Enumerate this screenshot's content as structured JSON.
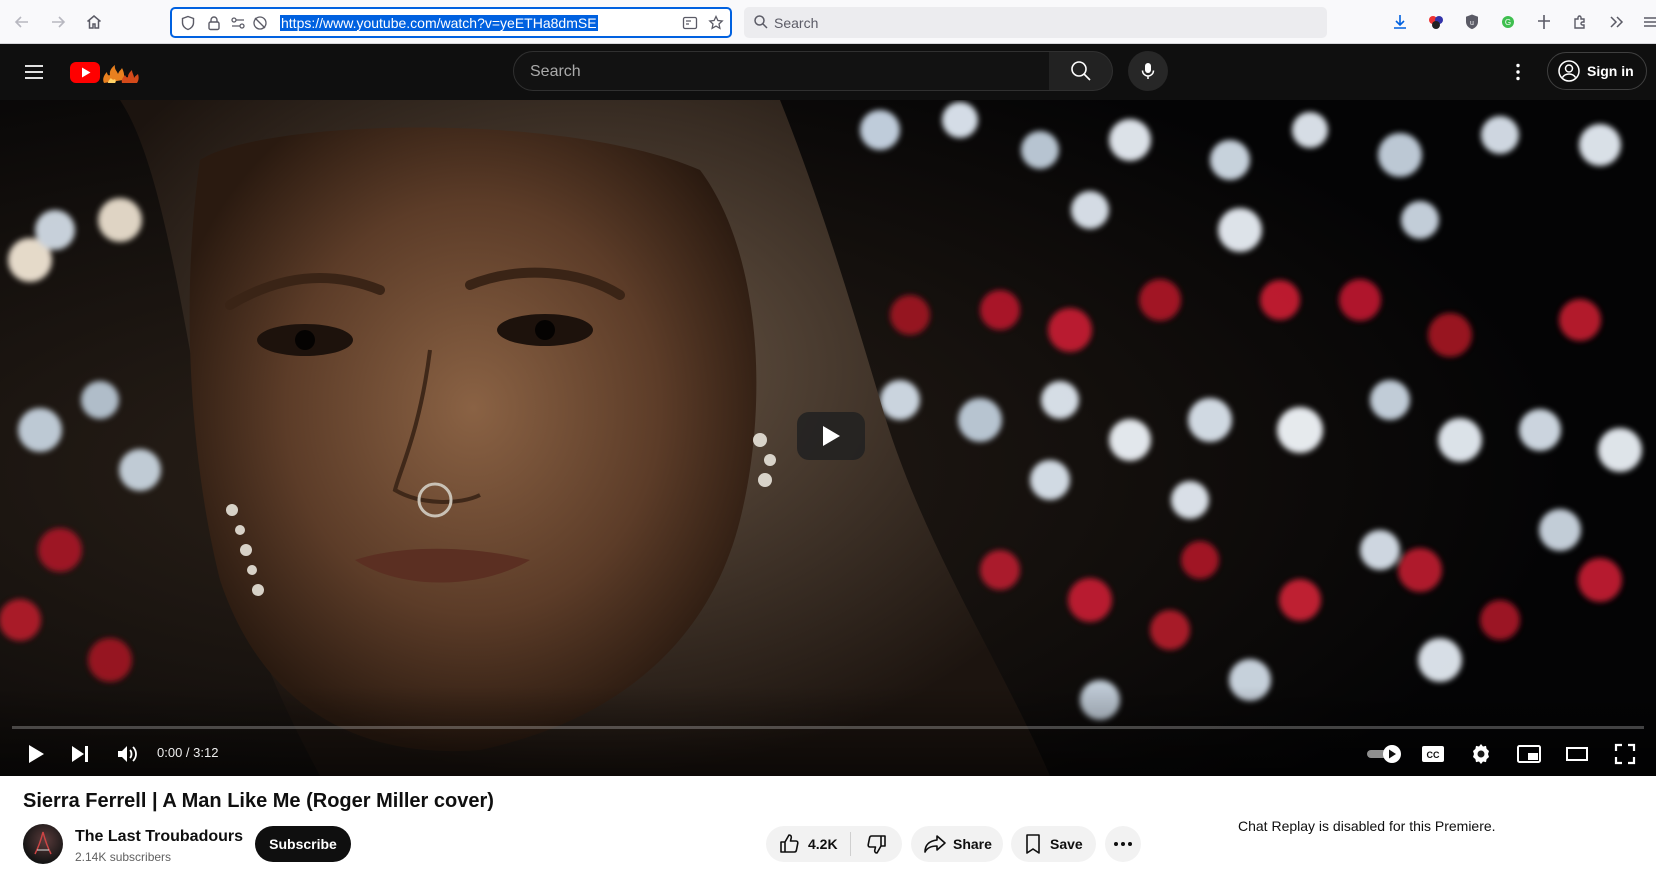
{
  "browser": {
    "url": "https://www.youtube.com/watch?v=yeETHa8dmSE",
    "search_placeholder": "Search"
  },
  "youtube": {
    "search_placeholder": "Search",
    "sign_in_label": "Sign in"
  },
  "player": {
    "time_display": "0:00 / 3:12",
    "progress": 0
  },
  "video": {
    "title": "Sierra Ferrell | A Man Like Me (Roger Miller cover)",
    "channel_name": "The Last Troubadours",
    "subscribers": "2.14K subscribers",
    "subscribe_label": "Subscribe",
    "likes": "4.2K",
    "share_label": "Share",
    "save_label": "Save",
    "chat_replay_notice": "Chat Replay is disabled for this Premiere."
  },
  "colors": {
    "url_highlight": "#0061e0",
    "youtube_red": "#ff0000",
    "header_bg": "#0f0f0f"
  }
}
